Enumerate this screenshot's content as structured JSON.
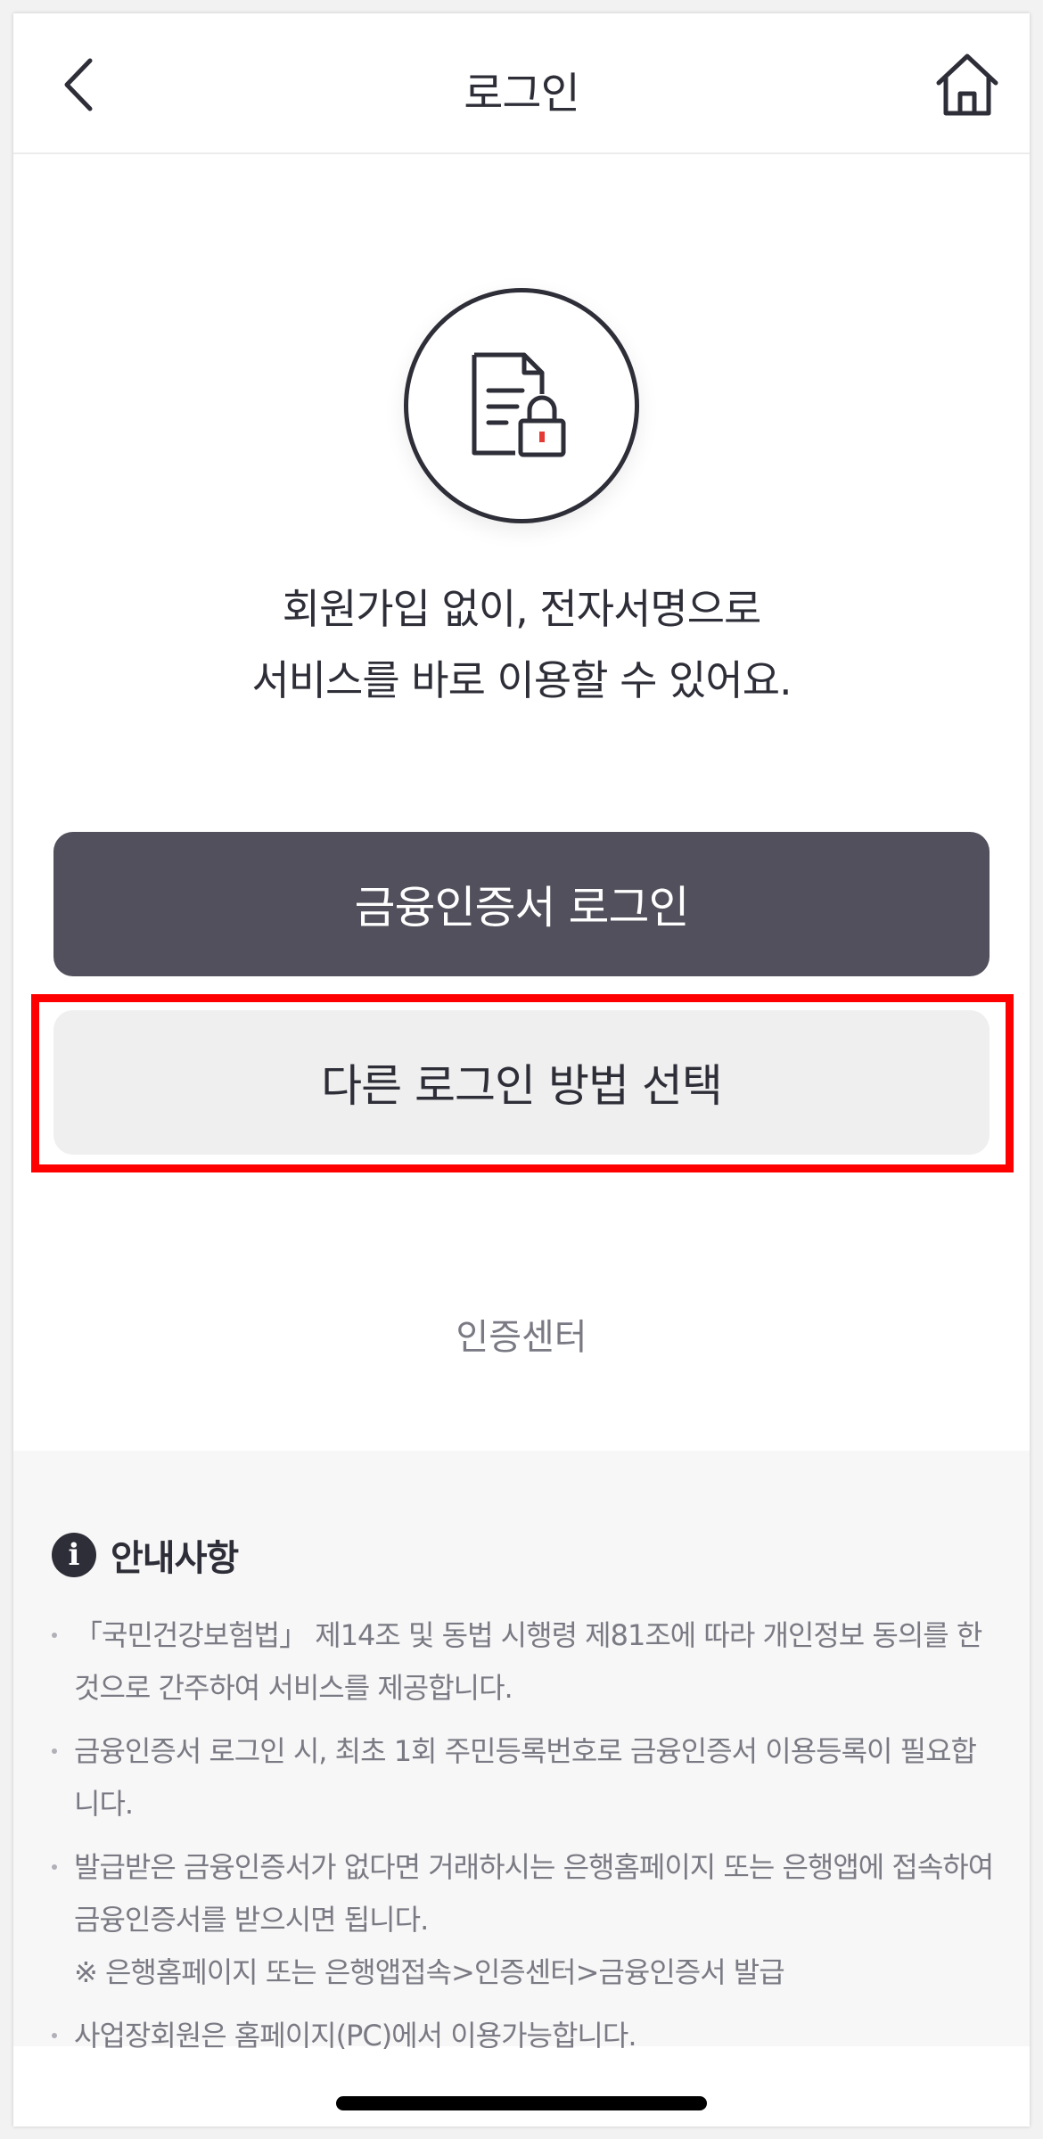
{
  "header": {
    "title": "로그인",
    "back_icon": "chevron-left-icon",
    "home_icon": "home-icon"
  },
  "hero": {
    "icon": "document-lock-icon",
    "line1": "회원가입 없이, 전자서명으로",
    "line2": "서비스를 바로 이용할 수 있어요."
  },
  "buttons": {
    "primary_label": "금융인증서 로그인",
    "secondary_label": "다른 로그인 방법 선택"
  },
  "links": {
    "cert_center": "인증센터"
  },
  "notice": {
    "title": "안내사항",
    "items": [
      {
        "text": "「국민건강보험법」 제14조 및 동법 시행령 제81조에 따라 개인정보 동의를 한 것으로 간주하여 서비스를 제공합니다."
      },
      {
        "text": "금융인증서 로그인 시, 최초 1회 주민등록번호로 금융인증서 이용등록이 필요합니다."
      },
      {
        "text": "발급받은 금융인증서가 없다면 거래하시는 은행홈페이지 또는 은행앱에 접속하여 금융인증서를 받으시면 됩니다.",
        "sub": "※ 은행홈페이지 또는 은행앱접속>인증센터>금융인증서 발급"
      },
      {
        "text": "사업장회원은 홈페이지(PC)에서 이용가능합니다."
      }
    ]
  },
  "colors": {
    "primary_button": "#52505c",
    "secondary_button": "#efefef",
    "highlight": "#ff0000",
    "text_dark": "#2e2e38",
    "text_muted": "#7a7a84",
    "lock_accent": "#e53935"
  }
}
